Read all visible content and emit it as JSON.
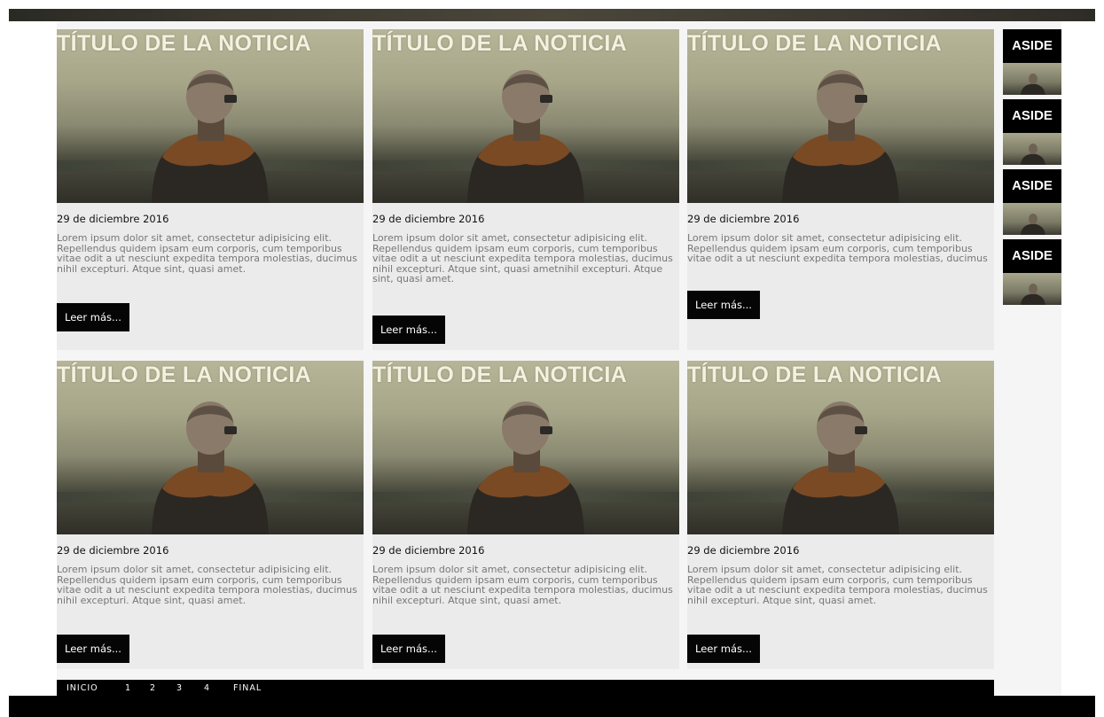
{
  "cards": [
    {
      "title": "TÍTULO DE LA NOTICIA",
      "date": "29 de diciembre 2016",
      "text": "Lorem ipsum dolor sit amet, consectetur adipisicing elit. Repellendus quidem ipsam eum corporis, cum temporibus vitae odit a ut nesciunt expedita tempora molestias, ducimus nihil excepturi. Atque sint, quasi amet.",
      "button": "Leer más..."
    },
    {
      "title": "TÍTULO DE LA NOTICIA",
      "date": "29 de diciembre 2016",
      "text": "Lorem ipsum dolor sit amet, consectetur adipisicing elit. Repellendus quidem ipsam eum corporis, cum temporibus vitae odit a ut nesciunt expedita tempora molestias, ducimus nihil excepturi. Atque sint, quasi ametnihil excepturi. Atque sint, quasi amet.",
      "button": "Leer más..."
    },
    {
      "title": "TÍTULO DE LA NOTICIA",
      "date": "29 de diciembre 2016",
      "text": "Lorem ipsum dolor sit amet, consectetur adipisicing elit. Repellendus quidem ipsam eum corporis, cum temporibus vitae odit a ut nesciunt expedita tempora molestias, ducimus",
      "button": "Leer más..."
    },
    {
      "title": "TÍTULO DE LA NOTICIA",
      "date": "29 de diciembre 2016",
      "text": "Lorem ipsum dolor sit amet, consectetur adipisicing elit. Repellendus quidem ipsam eum corporis, cum temporibus vitae odit a ut nesciunt expedita tempora molestias, ducimus nihil excepturi. Atque sint, quasi amet.",
      "button": "Leer más..."
    },
    {
      "title": "TÍTULO DE LA NOTICIA",
      "date": "29 de diciembre 2016",
      "text": "Lorem ipsum dolor sit amet, consectetur adipisicing elit. Repellendus quidem ipsam eum corporis, cum temporibus vitae odit a ut nesciunt expedita tempora molestias, ducimus nihil excepturi. Atque sint, quasi amet.",
      "button": "Leer más..."
    },
    {
      "title": "TÍTULO DE LA NOTICIA",
      "date": "29 de diciembre 2016",
      "text": "Lorem ipsum dolor sit amet, consectetur adipisicing elit. Repellendus quidem ipsam eum corporis, cum temporibus vitae odit a ut nesciunt expedita tempora molestias, ducimus nihil excepturi. Atque sint, quasi amet.",
      "button": "Leer más..."
    }
  ],
  "aside": [
    {
      "label": "ASIDE"
    },
    {
      "label": "ASIDE"
    },
    {
      "label": "ASIDE"
    },
    {
      "label": "ASIDE"
    }
  ],
  "pagination": [
    "INICIO",
    "1",
    "2",
    "3",
    "4",
    "FINAL"
  ]
}
